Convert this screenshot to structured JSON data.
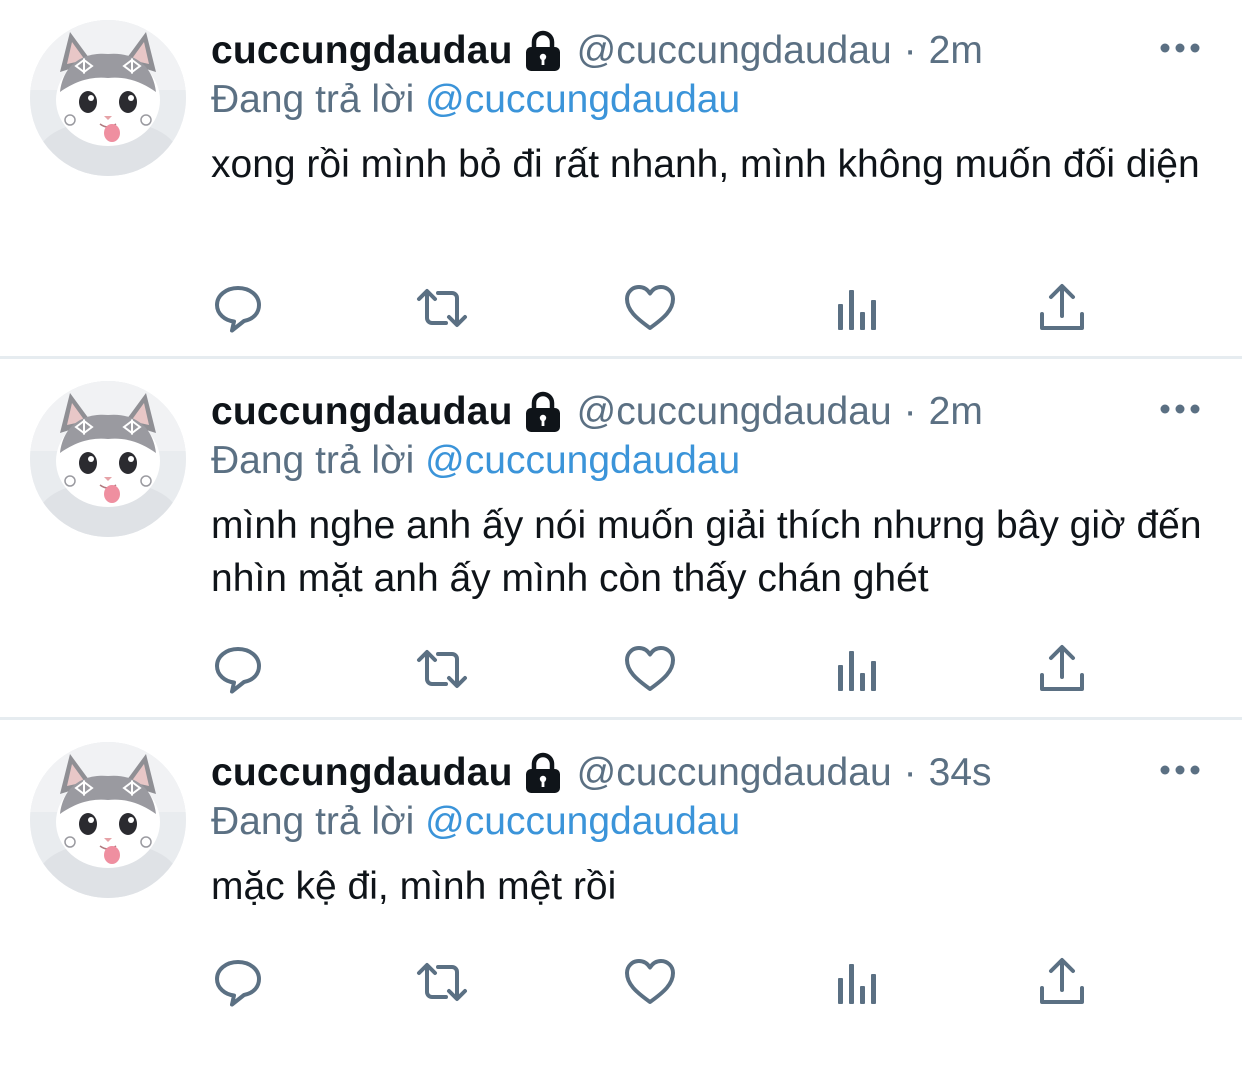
{
  "colors": {
    "text_primary": "#0f1419",
    "text_secondary": "#5b7083",
    "mention": "#3b94d9",
    "divider": "#e6ecf0",
    "icon": "#5b7083"
  },
  "icons": {
    "protected": "lock-icon",
    "more": "more-icon",
    "reply": "reply-icon",
    "retweet": "retweet-icon",
    "like": "heart-icon",
    "analytics": "analytics-icon",
    "share": "share-icon"
  },
  "tweets": [
    {
      "display_name": "cuccungdaudau",
      "handle": "@cuccungdaudau",
      "separator": "·",
      "time": "2m",
      "reply_prefix": "Đang trả lời",
      "reply_to": "@cuccungdaudau",
      "text": "xong rồi mình bỏ đi rất nhanh, mình không muốn đối diện"
    },
    {
      "display_name": "cuccungdaudau",
      "handle": "@cuccungdaudau",
      "separator": "·",
      "time": "2m",
      "reply_prefix": "Đang trả lời",
      "reply_to": "@cuccungdaudau",
      "text": "mình nghe anh ấy nói muốn giải thích nhưng bây giờ đến nhìn mặt anh ấy mình còn thấy chán ghét"
    },
    {
      "display_name": "cuccungdaudau",
      "handle": "@cuccungdaudau",
      "separator": "·",
      "time": "34s",
      "reply_prefix": "Đang trả lời",
      "reply_to": "@cuccungdaudau",
      "text": "mặc kệ đi, mình mệt rồi"
    }
  ]
}
